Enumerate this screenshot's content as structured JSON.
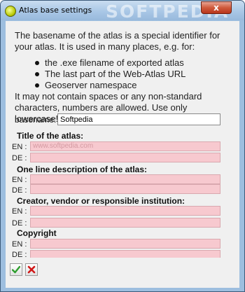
{
  "window": {
    "title": "Atlas base settings",
    "watermark": "SOFTPEDIA",
    "close_symbol": "x"
  },
  "intro": {
    "text": "The basename of the atlas is a special identifier for your atlas. It is used in many places, e.g. for:",
    "bullets": [
      "the .exe filename of exported atlas",
      "The last part of the Web-Atlas URL",
      "Geoserver namespace"
    ]
  },
  "warning": "It may not contain spaces or any non-standard characters, numbers are allowed. Use only lowercase!",
  "basename": {
    "label": "basename:",
    "value": "Softpedia"
  },
  "sections": [
    {
      "heading": "Title of the atlas:",
      "en_value": "www.softpedia.com",
      "de_value": ""
    },
    {
      "heading": "One line description of the atlas:",
      "en_value": "",
      "de_value": ""
    },
    {
      "heading": "Creator, vendor or responsible institution:",
      "en_value": "",
      "de_value": ""
    },
    {
      "heading": "Copyright",
      "en_value": "",
      "de_value": ""
    }
  ],
  "lang_labels": {
    "en": "EN :",
    "de": "DE :"
  },
  "buttons": {
    "ok_icon": "checkmark-icon",
    "cancel_icon": "red-x-icon"
  },
  "colors": {
    "field_background": "#f7c9cf",
    "ok_green": "#2e9e2e",
    "cancel_red": "#d01818"
  }
}
